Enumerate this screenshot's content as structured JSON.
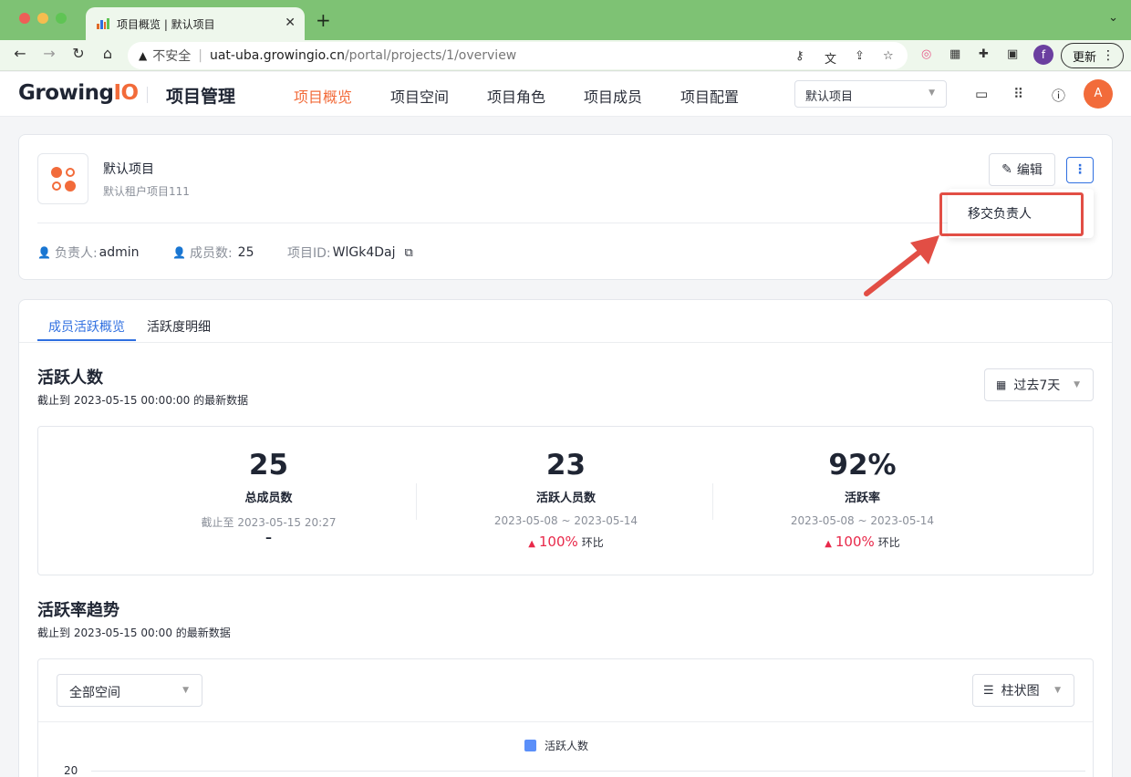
{
  "browser": {
    "tab_title": "项目概览 | 默认项目",
    "tab_close": "✕",
    "new_tab": "+",
    "insecure_label": "不安全",
    "url_host": "uat-uba.growingio.cn",
    "url_path": "/portal/projects/1/overview",
    "profile_initial": "f",
    "update_label": "更新"
  },
  "header": {
    "logo_main": "Growing",
    "logo_accent": "IO",
    "app_title": "项目管理",
    "menu": [
      {
        "label": "项目概览",
        "active": true
      },
      {
        "label": "项目空间",
        "active": false
      },
      {
        "label": "项目角色",
        "active": false
      },
      {
        "label": "项目成员",
        "active": false
      },
      {
        "label": "项目配置",
        "active": false
      }
    ],
    "project_select": "默认项目",
    "avatar_initial": "A"
  },
  "project": {
    "name": "默认项目",
    "description": "默认租户项目111",
    "owner_label": "负责人:",
    "owner": "admin",
    "members_label": "成员数:",
    "members": "25",
    "id_label": "项目ID:",
    "id": "WlGk4Daj",
    "edit_label": "编辑",
    "more_label": "⋮",
    "dropdown_item": "移交负责人"
  },
  "tabs": [
    {
      "label": "成员活跃概览",
      "active": true
    },
    {
      "label": "活跃度明细",
      "active": false
    }
  ],
  "active_section": {
    "title": "活跃人数",
    "subtitle": "截止到 2023-05-15 00:00:00 的最新数据",
    "range_select": "过去7天",
    "stats": [
      {
        "value": "25",
        "label": "总成员数",
        "date": "截止至 2023-05-15 20:27",
        "change": "–"
      },
      {
        "value": "23",
        "label": "活跃人员数",
        "date": "2023-05-08 ~ 2023-05-14",
        "change": "100%",
        "change_suffix": "环比"
      },
      {
        "value": "92%",
        "label": "活跃率",
        "date": "2023-05-08 ~ 2023-05-14",
        "change": "100%",
        "change_suffix": "环比"
      }
    ]
  },
  "trend_section": {
    "title": "活跃率趋势",
    "subtitle": "截止到 2023-05-15 00:00 的最新数据",
    "space_select": "全部空间",
    "chart_type_select": "柱状图",
    "legend": "活跃人数",
    "legend_color": "#5b8ff9",
    "y_tick_top": "20"
  },
  "colors": {
    "accent": "#f26b3a",
    "primary": "#2f6fe0",
    "up": "#e8294a",
    "highlight": "#e24e45"
  }
}
